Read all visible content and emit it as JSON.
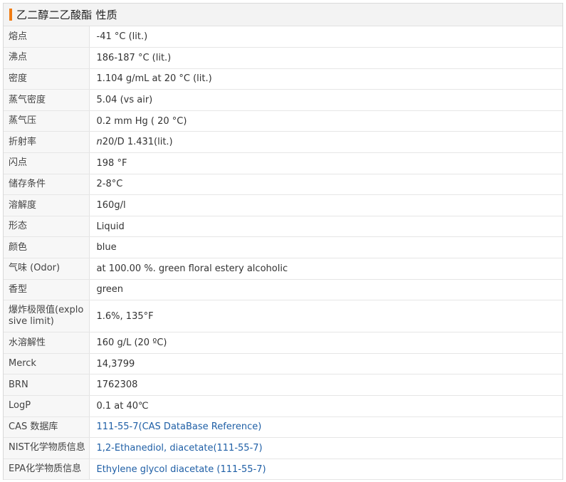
{
  "panel": {
    "title": "乙二醇二乙酸酯 性质",
    "accent_color": "#f07c14"
  },
  "rows": [
    {
      "key": "熔点",
      "value": "-41 °C (lit.)"
    },
    {
      "key": "沸点",
      "value": "186-187 °C (lit.)"
    },
    {
      "key": "密度",
      "value": "1.104 g/mL at 20 °C (lit.)"
    },
    {
      "key": "蒸气密度",
      "value": "5.04 (vs air)"
    },
    {
      "key": "蒸气压",
      "value": "0.2 mm Hg ( 20 °C)"
    },
    {
      "key": "折射率",
      "value_prefix_italic": "n",
      "value": "20/D 1.431(lit.)"
    },
    {
      "key": "闪点",
      "value": "198 °F"
    },
    {
      "key": "储存条件",
      "value": "2-8°C"
    },
    {
      "key": "溶解度",
      "value": "160g/l"
    },
    {
      "key": "形态",
      "value": "Liquid"
    },
    {
      "key": "颜色",
      "value": "blue"
    },
    {
      "key": "气味 (Odor)",
      "value": "at 100.00 %. green floral estery alcoholic"
    },
    {
      "key": "香型",
      "value": "green"
    },
    {
      "key": "爆炸极限值(explo\nsive limit)",
      "value": "1.6%, 135°F"
    },
    {
      "key": "水溶解性",
      "value": "160 g/L (20 ºC)"
    },
    {
      "key": "Merck",
      "value": "14,3799"
    },
    {
      "key": "BRN",
      "value": "1762308"
    },
    {
      "key": "LogP",
      "value": "0.1 at 40℃"
    },
    {
      "key": "CAS 数据库",
      "value": "111-55-7(CAS DataBase Reference)",
      "link": true
    },
    {
      "key": "NIST化学物质信息",
      "value": "1,2-Ethanediol, diacetate(111-55-7)",
      "link": true
    },
    {
      "key": "EPA化学物质信息",
      "value": "Ethylene glycol diacetate (111-55-7)",
      "link": true
    }
  ]
}
